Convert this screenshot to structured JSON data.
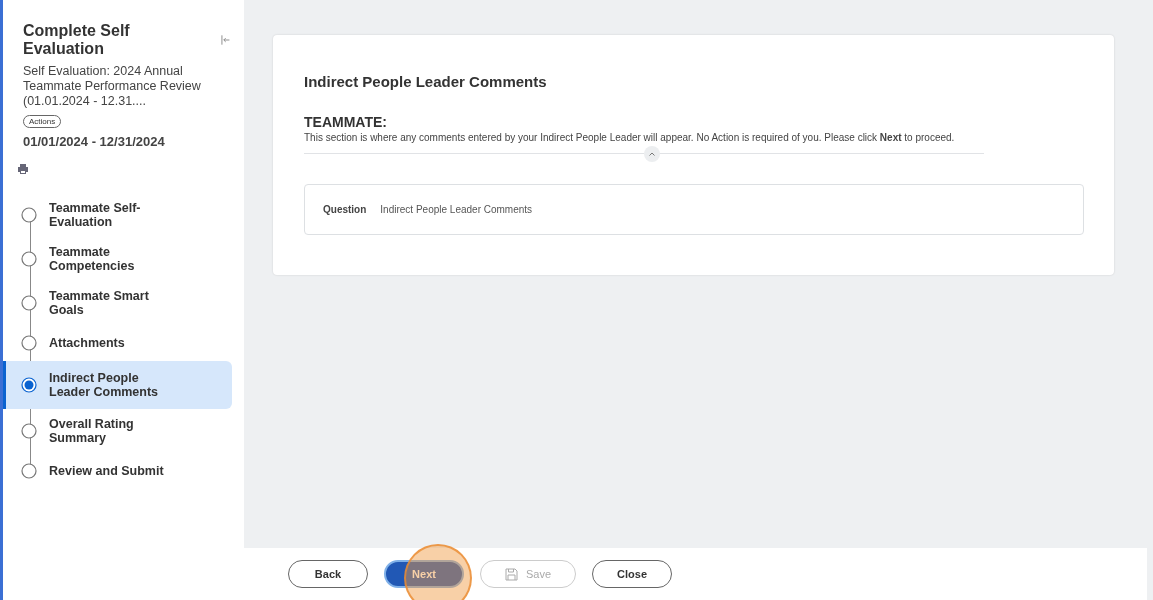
{
  "sidebar": {
    "title": "Complete Self Evaluation",
    "subtitle": "Self Evaluation: 2024 Annual Teammate Performance Review (01.01.2024 - 12.31....",
    "actions": "Actions",
    "dates": "01/01/2024 - 12/31/2024",
    "steps": [
      {
        "label": "Teammate Self-Evaluation",
        "selected": false
      },
      {
        "label": "Teammate Competencies",
        "selected": false
      },
      {
        "label": "Teammate Smart Goals",
        "selected": false
      },
      {
        "label": "Attachments",
        "selected": false
      },
      {
        "label": "Indirect People Leader Comments",
        "selected": true
      },
      {
        "label": "Overall Rating Summary",
        "selected": false
      },
      {
        "label": "Review and Submit",
        "selected": false
      }
    ]
  },
  "card": {
    "title": "Indirect People Leader Comments",
    "section_heading": "TEAMMATE:",
    "instruction": "This section is where any comments entered by your Indirect People Leader will appear. No Action is required of you. Please click **Next** to proceed.",
    "question_label": "Question",
    "question_text": "Indirect People Leader Comments"
  },
  "buttons": [
    {
      "label": "Back",
      "kind": "outline",
      "disabled": false,
      "highlighted": false
    },
    {
      "label": "Next",
      "kind": "primary",
      "disabled": false,
      "highlighted": true
    },
    {
      "label": "Save",
      "kind": "save",
      "disabled": true,
      "highlighted": false
    },
    {
      "label": "Close",
      "kind": "outline",
      "disabled": false,
      "highlighted": false
    }
  ]
}
